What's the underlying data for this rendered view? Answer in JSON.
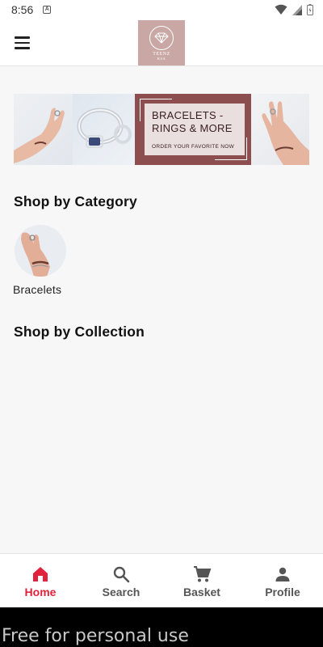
{
  "status_bar": {
    "time": "8:56",
    "notification_icon": "text-a-icon",
    "icons": [
      "wifi-icon",
      "signal-icon",
      "battery-icon"
    ]
  },
  "app_bar": {
    "menu_icon": "hamburger-menu-icon",
    "logo": {
      "brand": "TEENZ",
      "sub": "KSA",
      "icon": "diamond-icon",
      "color": "#c9a7a4"
    }
  },
  "banner": {
    "headline_line1": "BRACELETS -",
    "headline_line2": "RINGS & MORE",
    "subline": "ORDER YOUR FAVORITE NOW",
    "color": "#8c4e4e"
  },
  "categories": {
    "title": "Shop by Category",
    "items": [
      {
        "label": "Bracelets",
        "icon": "bracelet-hand-image"
      }
    ]
  },
  "collections": {
    "title": "Shop by Collection"
  },
  "bottom_nav": {
    "items": [
      {
        "label": "Home",
        "icon": "home-icon",
        "active": true
      },
      {
        "label": "Search",
        "icon": "search-icon",
        "active": false
      },
      {
        "label": "Basket",
        "icon": "cart-icon",
        "active": false
      },
      {
        "label": "Profile",
        "icon": "person-icon",
        "active": false
      }
    ],
    "active_color": "#e0223c"
  },
  "watermark": "Free for personal use"
}
